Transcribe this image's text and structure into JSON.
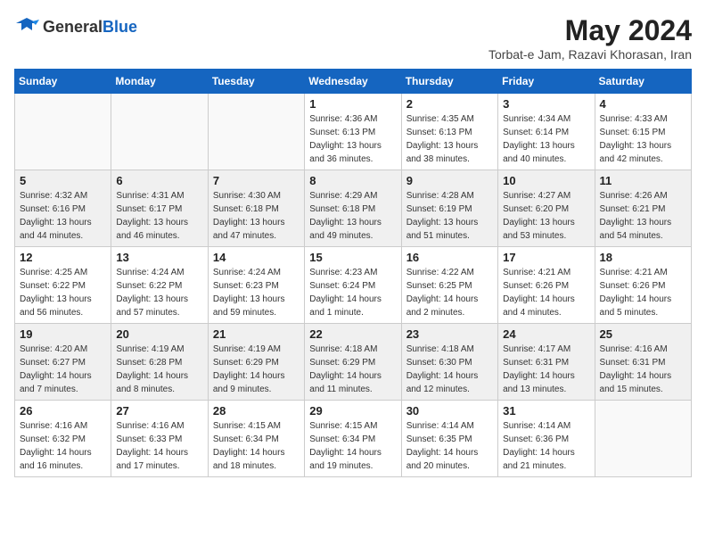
{
  "header": {
    "logo_general": "General",
    "logo_blue": "Blue",
    "month_year": "May 2024",
    "location": "Torbat-e Jam, Razavi Khorasan, Iran"
  },
  "weekdays": [
    "Sunday",
    "Monday",
    "Tuesday",
    "Wednesday",
    "Thursday",
    "Friday",
    "Saturday"
  ],
  "weeks": [
    [
      {
        "day": "",
        "info": ""
      },
      {
        "day": "",
        "info": ""
      },
      {
        "day": "",
        "info": ""
      },
      {
        "day": "1",
        "info": "Sunrise: 4:36 AM\nSunset: 6:13 PM\nDaylight: 13 hours and 36 minutes."
      },
      {
        "day": "2",
        "info": "Sunrise: 4:35 AM\nSunset: 6:13 PM\nDaylight: 13 hours and 38 minutes."
      },
      {
        "day": "3",
        "info": "Sunrise: 4:34 AM\nSunset: 6:14 PM\nDaylight: 13 hours and 40 minutes."
      },
      {
        "day": "4",
        "info": "Sunrise: 4:33 AM\nSunset: 6:15 PM\nDaylight: 13 hours and 42 minutes."
      }
    ],
    [
      {
        "day": "5",
        "info": "Sunrise: 4:32 AM\nSunset: 6:16 PM\nDaylight: 13 hours and 44 minutes."
      },
      {
        "day": "6",
        "info": "Sunrise: 4:31 AM\nSunset: 6:17 PM\nDaylight: 13 hours and 46 minutes."
      },
      {
        "day": "7",
        "info": "Sunrise: 4:30 AM\nSunset: 6:18 PM\nDaylight: 13 hours and 47 minutes."
      },
      {
        "day": "8",
        "info": "Sunrise: 4:29 AM\nSunset: 6:18 PM\nDaylight: 13 hours and 49 minutes."
      },
      {
        "day": "9",
        "info": "Sunrise: 4:28 AM\nSunset: 6:19 PM\nDaylight: 13 hours and 51 minutes."
      },
      {
        "day": "10",
        "info": "Sunrise: 4:27 AM\nSunset: 6:20 PM\nDaylight: 13 hours and 53 minutes."
      },
      {
        "day": "11",
        "info": "Sunrise: 4:26 AM\nSunset: 6:21 PM\nDaylight: 13 hours and 54 minutes."
      }
    ],
    [
      {
        "day": "12",
        "info": "Sunrise: 4:25 AM\nSunset: 6:22 PM\nDaylight: 13 hours and 56 minutes."
      },
      {
        "day": "13",
        "info": "Sunrise: 4:24 AM\nSunset: 6:22 PM\nDaylight: 13 hours and 57 minutes."
      },
      {
        "day": "14",
        "info": "Sunrise: 4:24 AM\nSunset: 6:23 PM\nDaylight: 13 hours and 59 minutes."
      },
      {
        "day": "15",
        "info": "Sunrise: 4:23 AM\nSunset: 6:24 PM\nDaylight: 14 hours and 1 minute."
      },
      {
        "day": "16",
        "info": "Sunrise: 4:22 AM\nSunset: 6:25 PM\nDaylight: 14 hours and 2 minutes."
      },
      {
        "day": "17",
        "info": "Sunrise: 4:21 AM\nSunset: 6:26 PM\nDaylight: 14 hours and 4 minutes."
      },
      {
        "day": "18",
        "info": "Sunrise: 4:21 AM\nSunset: 6:26 PM\nDaylight: 14 hours and 5 minutes."
      }
    ],
    [
      {
        "day": "19",
        "info": "Sunrise: 4:20 AM\nSunset: 6:27 PM\nDaylight: 14 hours and 7 minutes."
      },
      {
        "day": "20",
        "info": "Sunrise: 4:19 AM\nSunset: 6:28 PM\nDaylight: 14 hours and 8 minutes."
      },
      {
        "day": "21",
        "info": "Sunrise: 4:19 AM\nSunset: 6:29 PM\nDaylight: 14 hours and 9 minutes."
      },
      {
        "day": "22",
        "info": "Sunrise: 4:18 AM\nSunset: 6:29 PM\nDaylight: 14 hours and 11 minutes."
      },
      {
        "day": "23",
        "info": "Sunrise: 4:18 AM\nSunset: 6:30 PM\nDaylight: 14 hours and 12 minutes."
      },
      {
        "day": "24",
        "info": "Sunrise: 4:17 AM\nSunset: 6:31 PM\nDaylight: 14 hours and 13 minutes."
      },
      {
        "day": "25",
        "info": "Sunrise: 4:16 AM\nSunset: 6:31 PM\nDaylight: 14 hours and 15 minutes."
      }
    ],
    [
      {
        "day": "26",
        "info": "Sunrise: 4:16 AM\nSunset: 6:32 PM\nDaylight: 14 hours and 16 minutes."
      },
      {
        "day": "27",
        "info": "Sunrise: 4:16 AM\nSunset: 6:33 PM\nDaylight: 14 hours and 17 minutes."
      },
      {
        "day": "28",
        "info": "Sunrise: 4:15 AM\nSunset: 6:34 PM\nDaylight: 14 hours and 18 minutes."
      },
      {
        "day": "29",
        "info": "Sunrise: 4:15 AM\nSunset: 6:34 PM\nDaylight: 14 hours and 19 minutes."
      },
      {
        "day": "30",
        "info": "Sunrise: 4:14 AM\nSunset: 6:35 PM\nDaylight: 14 hours and 20 minutes."
      },
      {
        "day": "31",
        "info": "Sunrise: 4:14 AM\nSunset: 6:36 PM\nDaylight: 14 hours and 21 minutes."
      },
      {
        "day": "",
        "info": ""
      }
    ]
  ],
  "row_classes": [
    "row-white",
    "row-shaded",
    "row-white",
    "row-shaded",
    "row-white"
  ]
}
